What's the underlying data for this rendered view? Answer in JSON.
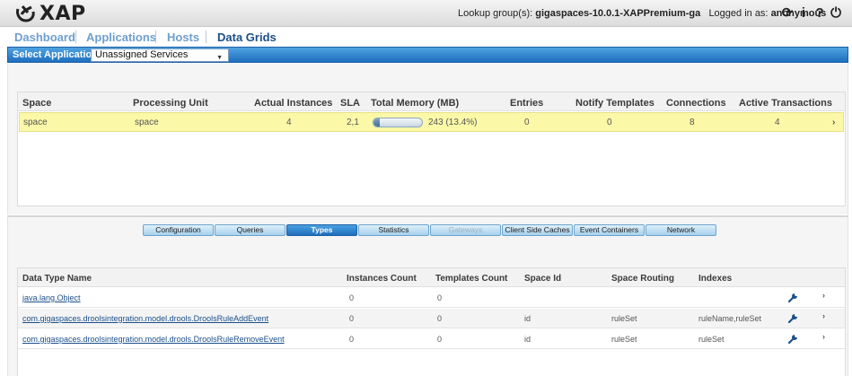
{
  "header": {
    "logo_text": "XAP",
    "lookup_label": "Lookup group(s):",
    "lookup_value": "gigaspaces-10.0.1-XAPPremium-ga",
    "logged_label": "Logged in as:",
    "logged_value": "anonymous",
    "icons": [
      "refresh-icon",
      "info-icon",
      "help-icon",
      "power-icon"
    ],
    "icon_glyphs": [
      "⟳",
      "i",
      "?",
      "⏻"
    ]
  },
  "nav": {
    "tabs": [
      {
        "label": "Dashboard"
      },
      {
        "label": "Applications"
      },
      {
        "label": "Hosts"
      },
      {
        "label": "Data Grids"
      }
    ],
    "active": "Data Grids"
  },
  "app_selector": {
    "label": "Select Application:",
    "value": "Unassigned Services"
  },
  "spaces": {
    "columns": [
      "Space",
      "Processing Unit",
      "Actual Instances",
      "SLA",
      "Total Memory (MB)",
      "Entries",
      "Notify Templates",
      "Connections",
      "Active Transactions"
    ],
    "rows": [
      {
        "space": "space",
        "processing_unit": "space",
        "actual_instances": "4",
        "sla": "2,1",
        "memory_text": "243 (13.4%)",
        "memory_fraction": 0.134,
        "entries": "0",
        "notify_templates": "0",
        "connections": "8",
        "active_transactions": "4"
      }
    ]
  },
  "subtabs": [
    {
      "label": "Configuration",
      "state": "normal"
    },
    {
      "label": "Queries",
      "state": "normal"
    },
    {
      "label": "Types",
      "state": "active"
    },
    {
      "label": "Statistics",
      "state": "normal"
    },
    {
      "label": "Gateways",
      "state": "disabled"
    },
    {
      "label": "Client Side Caches",
      "state": "normal"
    },
    {
      "label": "Event Containers",
      "state": "normal"
    },
    {
      "label": "Network",
      "state": "normal"
    }
  ],
  "types": {
    "columns": [
      "Data Type Name",
      "Instances Count",
      "Templates Count",
      "Space Id",
      "Space Routing",
      "Indexes"
    ],
    "rows": [
      {
        "name": "java.lang.Object",
        "instances": "0",
        "templates": "0",
        "space_id": "",
        "routing": "",
        "indexes": ""
      },
      {
        "name": "com.gigaspaces.droolsintegration.model.drools.DroolsRuleAddEvent",
        "instances": "0",
        "templates": "0",
        "space_id": "id",
        "routing": "ruleSet",
        "indexes": "ruleName,ruleSet"
      },
      {
        "name": "com.gigaspaces.droolsintegration.model.drools.DroolsRuleRemoveEvent",
        "instances": "0",
        "templates": "0",
        "space_id": "id",
        "routing": "ruleSet",
        "indexes": "ruleSet"
      }
    ]
  },
  "colors": {
    "accent": "#1e6fbf",
    "selected_row": "#fbf8a8",
    "link": "#1b4f8a"
  }
}
